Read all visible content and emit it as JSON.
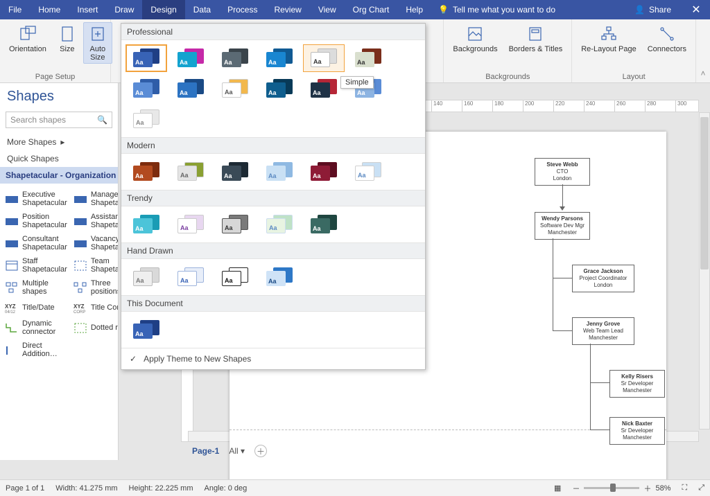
{
  "menu": {
    "tabs": [
      "File",
      "Home",
      "Insert",
      "Draw",
      "Design",
      "Data",
      "Process",
      "Review",
      "View",
      "Org Chart",
      "Help"
    ],
    "active_index": 4,
    "tell_me": "Tell me what you want to do",
    "share": "Share"
  },
  "ribbon": {
    "page_setup": {
      "orientation": "Orientation",
      "size": "Size",
      "autosize": "Auto Size",
      "group": "Page Setup"
    },
    "backgrounds": {
      "bg": "Backgrounds",
      "bt": "Borders & Titles",
      "group": "Backgrounds"
    },
    "layout": {
      "relayout": "Re-Layout Page",
      "connectors": "Connectors",
      "group": "Layout"
    }
  },
  "themes": {
    "hover_tooltip": "Simple",
    "sections": {
      "professional": {
        "label": "Professional",
        "items": [
          {
            "front": "#3863b6",
            "back": "#1f3f85",
            "text": "#fff",
            "current": true
          },
          {
            "front": "#13a3cf",
            "back": "#c529a8",
            "text": "#fff"
          },
          {
            "front": "#5b6a74",
            "back": "#3a444b",
            "text": "#fff"
          },
          {
            "front": "#1986d1",
            "back": "#105a93",
            "text": "#fff"
          },
          {
            "front": "#ffffff",
            "back": "#dcdcdc",
            "text": "#333",
            "border": "#bbb",
            "hover": true
          },
          {
            "front": "#d9dfce",
            "back": "#7a2e1b",
            "text": "#333"
          },
          {
            "front": "#5a8cd6",
            "back": "#2f5da8",
            "text": "#fff"
          },
          {
            "front": "#2c73c2",
            "back": "#1a4a85",
            "text": "#fff"
          },
          {
            "front": "#ffffff",
            "back": "#f2b84d",
            "text": "#555",
            "border": "#ccc"
          },
          {
            "front": "#0f5e8e",
            "back": "#083a58",
            "text": "#fff"
          },
          {
            "front": "#1f3246",
            "back": "#b62637",
            "text": "#fff"
          },
          {
            "front": "#8db4e2",
            "back": "#5a8cd6",
            "text": "#fff"
          },
          {
            "front": "#ffffff",
            "back": "#e8e8e8",
            "text": "#888",
            "border": "#ccc"
          }
        ]
      },
      "modern": {
        "label": "Modern",
        "items": [
          {
            "front": "#b24a1f",
            "back": "#7d2c0e",
            "text": "#fff"
          },
          {
            "front": "#e4e4e4",
            "back": "#8aa032",
            "text": "#666",
            "border": "#ccc"
          },
          {
            "front": "#3a4a57",
            "back": "#1d2a34",
            "text": "#fff"
          },
          {
            "front": "#c9e0f4",
            "back": "#8fb9e2",
            "text": "#5c8ac2"
          },
          {
            "front": "#8e1b36",
            "back": "#5d0d20",
            "text": "#fff"
          },
          {
            "front": "#ffffff",
            "back": "#c9e0f4",
            "text": "#5c8ac2",
            "border": "#d0d0d0"
          }
        ]
      },
      "trendy": {
        "label": "Trendy",
        "items": [
          {
            "front": "#4cc4d9",
            "back": "#1a9cb5",
            "text": "#fff"
          },
          {
            "front": "#ffffff",
            "back": "#e8d7f0",
            "text": "#7a3fa0",
            "border": "#ccc"
          },
          {
            "front": "#d7d7d7",
            "back": "#7a7a7a",
            "text": "#333",
            "border": "#555"
          },
          {
            "front": "#e8f4e2",
            "back": "#bfe2c7",
            "text": "#5c8ac2",
            "border": "#cde"
          },
          {
            "front": "#3a6a63",
            "back": "#1f4640",
            "text": "#fff"
          }
        ]
      },
      "handdrawn": {
        "label": "Hand Drawn",
        "items": [
          {
            "front": "#efefef",
            "back": "#d9d9d9",
            "text": "#777",
            "border": "#bbb"
          },
          {
            "front": "#ffffff",
            "back": "#e8eef9",
            "text": "#3863b6",
            "border": "#9cb3dc"
          },
          {
            "front": "#ffffff",
            "back": "#ffffff",
            "text": "#111",
            "border": "#222"
          },
          {
            "front": "#cfe3f7",
            "back": "#2e78c7",
            "text": "#1a4a85"
          }
        ]
      },
      "thisdoc": {
        "label": "This Document",
        "items": [
          {
            "front": "#3863b6",
            "back": "#1f3f85",
            "text": "#fff"
          }
        ]
      }
    },
    "footer": "Apply Theme to New Shapes"
  },
  "shapes": {
    "title": "Shapes",
    "search_placeholder": "Search shapes",
    "more": "More Shapes",
    "quick": "Quick Shapes",
    "stencil": "Shapetacular - Organization Chart",
    "items": [
      {
        "a": "Executive Shapetacular",
        "b": "Manager Shapetacular"
      },
      {
        "a": "Position Shapetacular",
        "b": "Assistant Shapetacular"
      },
      {
        "a": "Consultant Shapetacular",
        "b": "Vacancy Shapetacular"
      },
      {
        "a": "Staff Shapetacular",
        "b": "Team Shapetacular"
      },
      {
        "a": "Multiple shapes",
        "b": "Three positions"
      },
      {
        "a": "Title/Date",
        "b": "Title Corp"
      },
      {
        "a": "Dynamic connector",
        "b": "Dotted report"
      },
      {
        "a": "Direct Addition…",
        "b": ""
      }
    ]
  },
  "ruler_ticks": [
    140,
    160,
    180,
    200,
    220,
    240,
    260,
    280,
    300
  ],
  "chart": {
    "n0": {
      "name": "Steve Webb",
      "title": "CTO",
      "loc": "London"
    },
    "n1": {
      "name": "Wendy Parsons",
      "title": "Software Dev Mgr",
      "loc": "Manchester"
    },
    "n2": {
      "name": "Grace Jackson",
      "title": "Project Coordinator",
      "loc": "London"
    },
    "n3": {
      "name": "Jenny Grove",
      "title": "Web Team Lead",
      "loc": "Manchester"
    },
    "n4": {
      "name": "Kelly Risers",
      "title": "Sr Developer",
      "loc": "Manchester"
    },
    "n5": {
      "name": "Nick Baxter",
      "title": "Sr Developer",
      "loc": "Manchester"
    }
  },
  "page_tabs": {
    "page": "Page-1",
    "all": "All"
  },
  "status": {
    "page": "Page 1 of 1",
    "width": "Width: 41.275 mm",
    "height": "Height: 22.225 mm",
    "angle": "Angle: 0 deg",
    "zoom": "58%"
  }
}
